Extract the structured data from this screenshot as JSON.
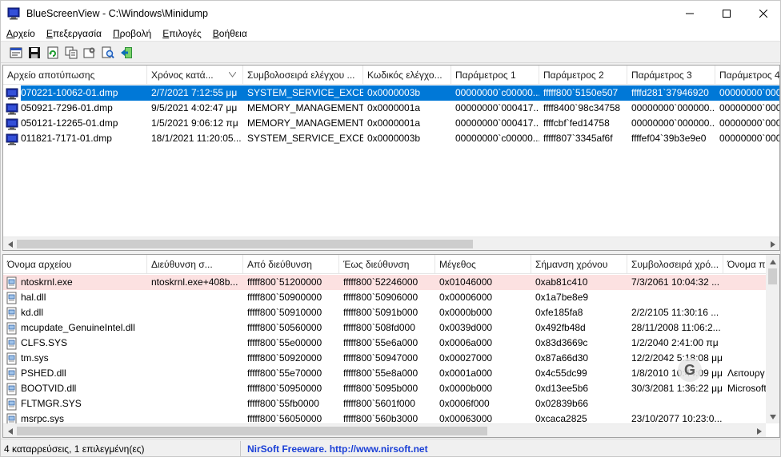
{
  "window": {
    "title": "BlueScreenView  -  C:\\Windows\\Minidump",
    "controls": {
      "minimize": "minimize-icon",
      "maximize": "maximize-icon",
      "close": "close-icon"
    }
  },
  "menu": [
    {
      "label": "Αρχείο"
    },
    {
      "label": "Επεξεργασία"
    },
    {
      "label": "Προβολή"
    },
    {
      "label": "Επιλογές"
    },
    {
      "label": "Βοήθεια"
    }
  ],
  "toolbar": [
    "properties-icon",
    "save-icon",
    "refresh-icon",
    "copy-icon",
    "options-icon",
    "find-icon",
    "exit-icon"
  ],
  "crash_list": {
    "columns": [
      {
        "label": "Αρχείο αποτύπωσης",
        "sorted": false
      },
      {
        "label": "Χρόνος κατά...",
        "sorted": true
      },
      {
        "label": "Συμβολοσειρά ελέγχου ...",
        "sorted": false
      },
      {
        "label": "Κωδικός ελέγχο...",
        "sorted": false
      },
      {
        "label": "Παράμετρος 1",
        "sorted": false
      },
      {
        "label": "Παράμετρος 2",
        "sorted": false
      },
      {
        "label": "Παράμετρος 3",
        "sorted": false
      },
      {
        "label": "Παράμετρος 4",
        "sorted": false
      }
    ],
    "rows": [
      {
        "selected": true,
        "cells": [
          "070221-10062-01.dmp",
          "2/7/2021 7:12:55 μμ",
          "SYSTEM_SERVICE_EXCEP...",
          "0x0000003b",
          "00000000`c00000...",
          "fffff800`5150e507",
          "ffffd281`37946920",
          "00000000`0000"
        ]
      },
      {
        "selected": false,
        "cells": [
          "050921-7296-01.dmp",
          "9/5/2021 4:02:47 μμ",
          "MEMORY_MANAGEMENT",
          "0x0000001a",
          "00000000`000417...",
          "ffff8400`98c34758",
          "00000000`000000...",
          "00000000`0000"
        ]
      },
      {
        "selected": false,
        "cells": [
          "050121-12265-01.dmp",
          "1/5/2021 9:06:12 πμ",
          "MEMORY_MANAGEMENT",
          "0x0000001a",
          "00000000`000417...",
          "ffffcbf`fed14758",
          "00000000`000000...",
          "00000000`0000"
        ]
      },
      {
        "selected": false,
        "cells": [
          "011821-7171-01.dmp",
          "18/1/2021 11:20:05...",
          "SYSTEM_SERVICE_EXCEP...",
          "0x0000003b",
          "00000000`c00000...",
          "fffff807`3345af6f",
          "ffffef04`39b3e9e0",
          "00000000`0000"
        ]
      }
    ]
  },
  "driver_list": {
    "columns": [
      {
        "label": "Όνομα αρχείου"
      },
      {
        "label": "Διεύθυνση σ..."
      },
      {
        "label": "Από διεύθυνση"
      },
      {
        "label": "Έως διεύθυνση"
      },
      {
        "label": "Μέγεθος"
      },
      {
        "label": "Σήμανση χρόνου"
      },
      {
        "label": "Συμβολοσειρά χρό..."
      },
      {
        "label": "Όνομα π"
      }
    ],
    "rows": [
      {
        "highlight": true,
        "cells": [
          "ntoskrnl.exe",
          "ntoskrnl.exe+408b...",
          "fffff800`51200000",
          "fffff800`52246000",
          "0x01046000",
          "0xab81c410",
          "7/3/2061 10:04:32 ...",
          ""
        ]
      },
      {
        "highlight": false,
        "cells": [
          "hal.dll",
          "",
          "fffff800`50900000",
          "fffff800`50906000",
          "0x00006000",
          "0x1a7be8e9",
          "",
          ""
        ]
      },
      {
        "highlight": false,
        "cells": [
          "kd.dll",
          "",
          "fffff800`50910000",
          "fffff800`5091b000",
          "0x0000b000",
          "0xfe185fa8",
          "2/2/2105 11:30:16 ...",
          ""
        ]
      },
      {
        "highlight": false,
        "cells": [
          "mcupdate_GenuineIntel.dll",
          "",
          "fffff800`50560000",
          "fffff800`508fd000",
          "0x0039d000",
          "0x492fb48d",
          "28/11/2008 11:06:2...",
          ""
        ]
      },
      {
        "highlight": false,
        "cells": [
          "CLFS.SYS",
          "",
          "fffff800`55e00000",
          "fffff800`55e6a000",
          "0x0006a000",
          "0x83d3669c",
          "1/2/2040 2:41:00 πμ",
          ""
        ]
      },
      {
        "highlight": false,
        "cells": [
          "tm.sys",
          "",
          "fffff800`50920000",
          "fffff800`50947000",
          "0x00027000",
          "0x87a66d30",
          "12/2/2042 5:18:08 μμ",
          ""
        ]
      },
      {
        "highlight": false,
        "cells": [
          "PSHED.dll",
          "",
          "fffff800`55e70000",
          "fffff800`55e8a000",
          "0x0001a000",
          "0x4c55dc99",
          "1/8/2010 10:44:09 μμ",
          "Λειτουργ"
        ]
      },
      {
        "highlight": false,
        "cells": [
          "BOOTVID.dll",
          "",
          "fffff800`50950000",
          "fffff800`5095b000",
          "0x0000b000",
          "0xd13ee5b6",
          "30/3/2081 1:36:22 μμ",
          "Microsoft"
        ]
      },
      {
        "highlight": false,
        "cells": [
          "FLTMGR.SYS",
          "",
          "fffff800`55fb0000",
          "fffff800`5601f000",
          "0x0006f000",
          "0x02839b66",
          "",
          ""
        ]
      },
      {
        "highlight": false,
        "cells": [
          "msrpc.sys",
          "",
          "fffff800`56050000",
          "fffff800`560b3000",
          "0x00063000",
          "0xcaca2825",
          "23/10/2077 10:23:0...",
          ""
        ]
      }
    ]
  },
  "status": {
    "summary": "4 καταρρεύσεις, 1 επιλεγμένη(ες)",
    "link": "NirSoft Freeware.  http://www.nirsoft.net"
  },
  "colors": {
    "selection": "#0078d7",
    "highlight_row": "#fce1e1",
    "link": "#1a3fd6"
  }
}
